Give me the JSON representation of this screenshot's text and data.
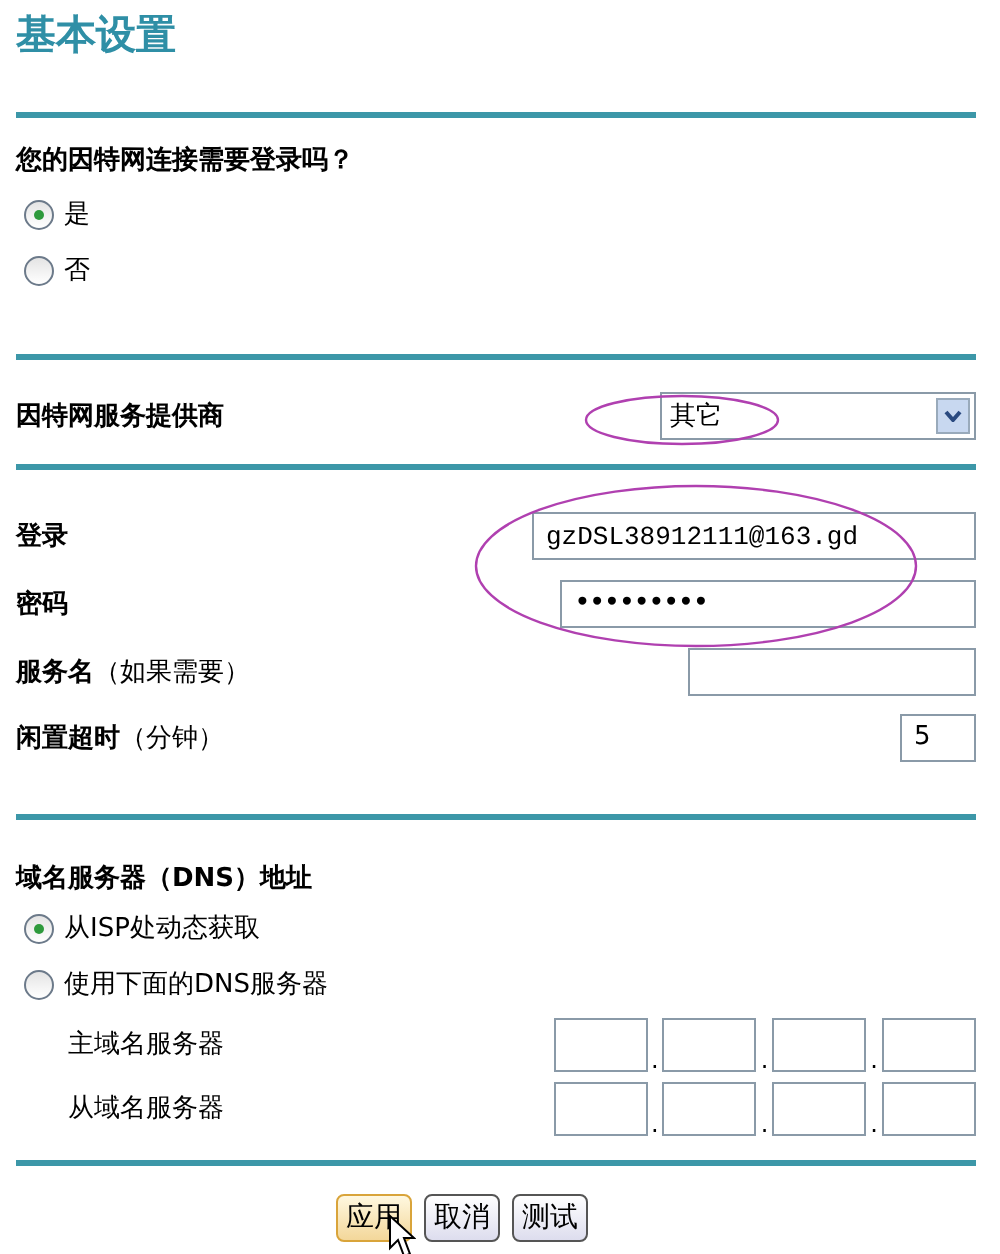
{
  "title": "基本设置",
  "login_question": {
    "label": "您的因特网连接需要登录吗？",
    "options": [
      {
        "label": "是",
        "selected": true
      },
      {
        "label": "否",
        "selected": false
      }
    ]
  },
  "isp": {
    "label": "因特网服务提供商",
    "value": "其它",
    "circled": true
  },
  "credentials": {
    "circled": true,
    "fields": [
      {
        "label": "登录",
        "value": "gzDSL38912111@163.gd",
        "kind": "text"
      },
      {
        "label": "密码",
        "value": "•••••••••",
        "kind": "password"
      }
    ]
  },
  "extra_fields": [
    {
      "label": "服务名",
      "hint": "（如果需要）"
    },
    {
      "label": "闲置超时",
      "hint": "（分钟）",
      "value": "5"
    }
  ],
  "dns": {
    "label": "域名服务器（DNS）地址",
    "options": [
      {
        "label": "从ISP处动态获取",
        "selected": true
      },
      {
        "label": "使用下面的DNS服务器",
        "selected": false
      }
    ],
    "servers": [
      {
        "label": "主域名服务器",
        "separators": [
          ".",
          ".",
          "."
        ]
      },
      {
        "label": "从域名服务器",
        "separators": [
          ".",
          ".",
          "."
        ]
      }
    ]
  },
  "buttons": [
    {
      "label": "应用",
      "hovered": true
    },
    {
      "label": "取消",
      "hovered": false
    },
    {
      "label": "测试",
      "hovered": false
    }
  ]
}
